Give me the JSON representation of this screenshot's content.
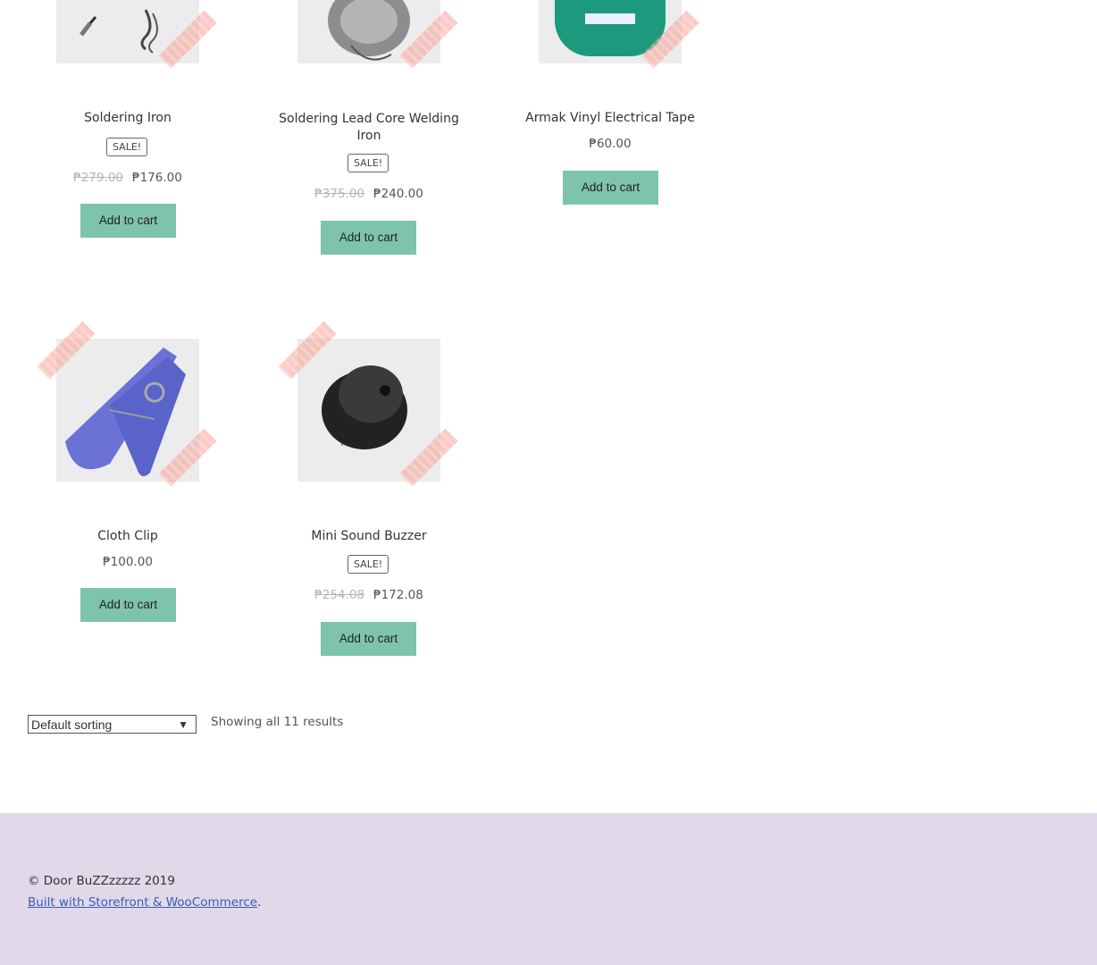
{
  "products": [
    {
      "title": "Soldering Iron",
      "sale_badge": "SALE!",
      "old_price": "₱279.00",
      "price": "₱176.00",
      "button": "Add to cart"
    },
    {
      "title": "Soldering Lead Core Welding Iron",
      "sale_badge": "SALE!",
      "old_price": "₱375.00",
      "price": "₱240.00",
      "button": "Add to cart"
    },
    {
      "title": "Armak Vinyl Electrical Tape",
      "price": "₱60.00",
      "button": "Add to cart"
    },
    {
      "title": "Cloth Clip",
      "price": "₱100.00",
      "button": "Add to cart"
    },
    {
      "title": "Mini Sound Buzzer",
      "sale_badge": "SALE!",
      "old_price": "₱254.08",
      "price": "₱172.08",
      "button": "Add to cart"
    }
  ],
  "toolbar": {
    "sorting": "Default sorting",
    "results": "Showing all 11 results"
  },
  "footer": {
    "copyright": "© Door BuZZzzzzz 2019",
    "credit_link": "Built with Storefront & WooCommerce",
    "credit_suffix": "."
  },
  "colors": {
    "button": "#7dc3ae",
    "footer_bg": "#e1d9ea",
    "tape": "#faa096"
  }
}
